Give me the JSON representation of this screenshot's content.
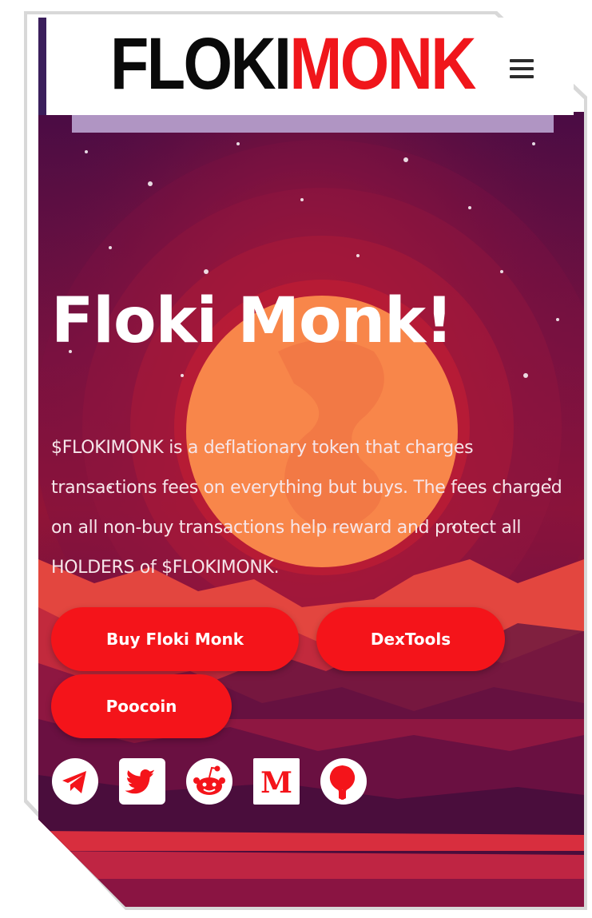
{
  "header": {
    "logo_part1": "FLOKI",
    "logo_part2": "MONK"
  },
  "hero": {
    "title": "Floki Monk!",
    "description": "$FLOKIMONK is a deflationary token that charges transactions fees on everything but buys. The fees charged on all non-buy transactions help reward and protect all HOLDERS of $FLOKIMONK."
  },
  "buttons": {
    "buy": "Buy Floki Monk",
    "dextools": "DexTools",
    "poocoin": "Poocoin"
  },
  "social": [
    {
      "icon": "telegram-icon"
    },
    {
      "icon": "twitter-icon"
    },
    {
      "icon": "reddit-icon"
    },
    {
      "icon": "medium-icon"
    },
    {
      "icon": "github-icon"
    }
  ],
  "colors": {
    "accent": "#f4141a",
    "logo_red": "#f0161b",
    "logo_black": "#0a0a0a",
    "sky_top": "#4a0c44",
    "sun": "#f8864a",
    "header_strip": "#b095c3"
  }
}
